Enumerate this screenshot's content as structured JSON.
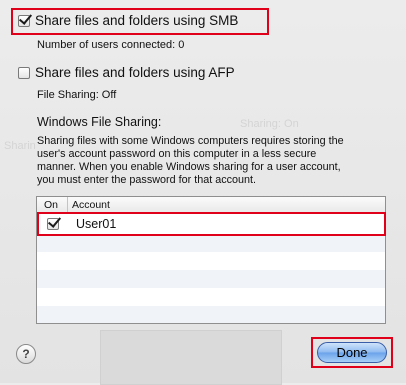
{
  "smb": {
    "label": "Share files and folders using SMB",
    "checked": true,
    "status": "Number of users connected: 0"
  },
  "afp": {
    "label": "Share files and folders using AFP",
    "checked": false,
    "status": "File Sharing: Off"
  },
  "windows_sharing": {
    "heading": "Windows File Sharing:",
    "description_lines": [
      "Sharing files with some Windows computers requires storing the",
      "user's account password on this computer in a less secure",
      "manner.  When you enable Windows sharing for a user account,",
      "you must enter the password for that account."
    ]
  },
  "accounts_table": {
    "columns": {
      "on": "On",
      "account": "Account"
    },
    "rows": [
      {
        "on": true,
        "account": "User01"
      }
    ]
  },
  "help_button": {
    "glyph": "?"
  },
  "done_button": {
    "label": "Done"
  },
  "highlight_color": "#e0001a",
  "accent_color": "#6aa2ea"
}
